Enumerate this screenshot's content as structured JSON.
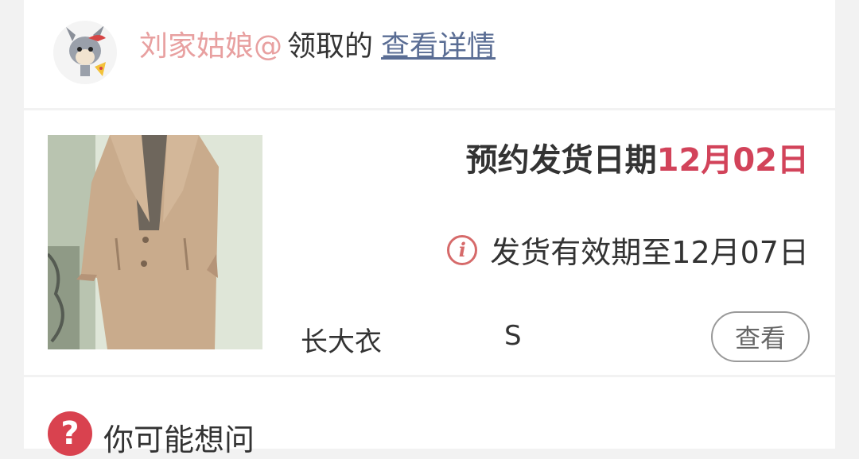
{
  "header": {
    "nickname": "刘家姑娘@",
    "claim_text": "领取的",
    "detail_link": "查看详情"
  },
  "order": {
    "ship_label": "预约发货日期",
    "ship_date": "12月02日",
    "valid_text": "发货有效期至12月07日",
    "info_icon": "info-icon",
    "product_name": "长大衣",
    "size": "S",
    "view_button": "查看"
  },
  "faq": {
    "title": "你可能想问",
    "icon": "question-icon"
  },
  "colors": {
    "accent": "#d2435a",
    "nickname": "#e8a0a0",
    "link": "#5a6d94"
  }
}
